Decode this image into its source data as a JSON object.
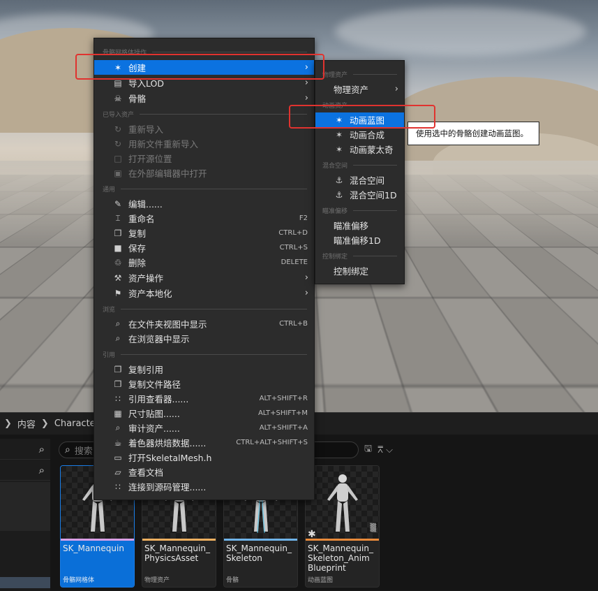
{
  "breadcrumb": {
    "items": [
      "内容",
      "Characte"
    ]
  },
  "search": {
    "placeholder": "搜索"
  },
  "assets": [
    {
      "name": "SK_Mannequin",
      "type": "骨骼网格体",
      "strip_color": "#d9a0e8",
      "selected": true
    },
    {
      "name": "SK_Mannequin_\nPhysicsAsset",
      "type": "物理资产",
      "strip_color": "#f0b060"
    },
    {
      "name": "SK_Mannequin_\nSkeleton",
      "type": "骨骼",
      "strip_color": "#6fb3e8"
    },
    {
      "name": "SK_Mannequin_\nSkeleton_Anim\nBlueprint",
      "type": "动画蓝图",
      "strip_color": "#e88a3a"
    }
  ],
  "main_menu": {
    "sections": {
      "skeletal_mesh_ops": "骨骼网格体操作",
      "imported_assets": "已导入资产",
      "common": "通用",
      "browse": "浏览",
      "references": "引用"
    },
    "items": {
      "create": "创建",
      "import_lod": "导入LOD",
      "skeleton": "骨骼",
      "reimport": "重新导入",
      "reimport_new_file": "用新文件重新导入",
      "open_source_location": "打开源位置",
      "open_in_external_editor": "在外部编辑器中打开",
      "edit": "编辑......",
      "rename": "重命名",
      "duplicate": "复制",
      "save": "保存",
      "delete": "删除",
      "asset_actions": "资产操作",
      "asset_localization": "资产本地化",
      "show_in_folder_view": "在文件夹视图中显示",
      "show_in_browser": "在浏览器中显示",
      "copy_reference": "复制引用",
      "copy_file_path": "复制文件路径",
      "reference_viewer": "引用查看器......",
      "size_map": "尺寸贴图......",
      "audit_assets": "审计资产......",
      "shader_cook_stats": "着色器烘焙数据......",
      "open_header": "打开SkeletalMesh.h",
      "view_documentation": "查看文档",
      "connect_source_control": "连接到源码管理......"
    },
    "shortcuts": {
      "rename": "F2",
      "duplicate": "CTRL+D",
      "save": "CTRL+S",
      "delete": "DELETE",
      "show_in_folder_view": "CTRL+B",
      "reference_viewer": "ALT+SHIFT+R",
      "size_map": "ALT+SHIFT+M",
      "audit_assets": "ALT+SHIFT+A",
      "shader_cook_stats": "CTRL+ALT+SHIFT+S"
    }
  },
  "sub_menu": {
    "sections": {
      "physics_asset": "物理资产",
      "animation_asset": "动画资产",
      "blend_space": "混合空间",
      "aim_offset": "瞄准偏移",
      "control_rig": "控制绑定"
    },
    "items": {
      "physics_asset": "物理资产",
      "anim_blueprint": "动画蓝图",
      "anim_composite": "动画合成",
      "anim_montage": "动画蒙太奇",
      "blend_space": "混合空间",
      "blend_space_1d": "混合空间1D",
      "aim_offset": "瞄准偏移",
      "aim_offset_1d": "瞄准偏移1D",
      "control_rig": "控制绑定"
    }
  },
  "tooltip": "使用选中的骨骼创建动画蓝图。",
  "colors": {
    "highlight": "#0b72e0",
    "annotation": "#e0332f",
    "menu_bg": "#2c2c2c"
  }
}
